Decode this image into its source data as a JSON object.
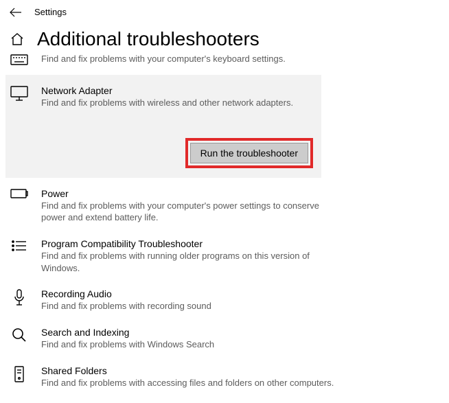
{
  "topbar": {
    "title": "Settings"
  },
  "header": {
    "title": "Additional troubleshooters"
  },
  "items": {
    "keyboard": {
      "desc": "Find and fix problems with your computer's keyboard settings."
    },
    "network": {
      "title": "Network Adapter",
      "desc": "Find and fix problems with wireless and other network adapters.",
      "run": "Run the troubleshooter"
    },
    "power": {
      "title": "Power",
      "desc": "Find and fix problems with your computer's power settings to conserve power and extend battery life."
    },
    "compat": {
      "title": "Program Compatibility Troubleshooter",
      "desc": "Find and fix problems with running older programs on this version of Windows."
    },
    "recording": {
      "title": "Recording Audio",
      "desc": "Find and fix problems with recording sound"
    },
    "search": {
      "title": "Search and Indexing",
      "desc": "Find and fix problems with Windows Search"
    },
    "shared": {
      "title": "Shared Folders",
      "desc": "Find and fix problems with accessing files and folders on other computers."
    }
  }
}
